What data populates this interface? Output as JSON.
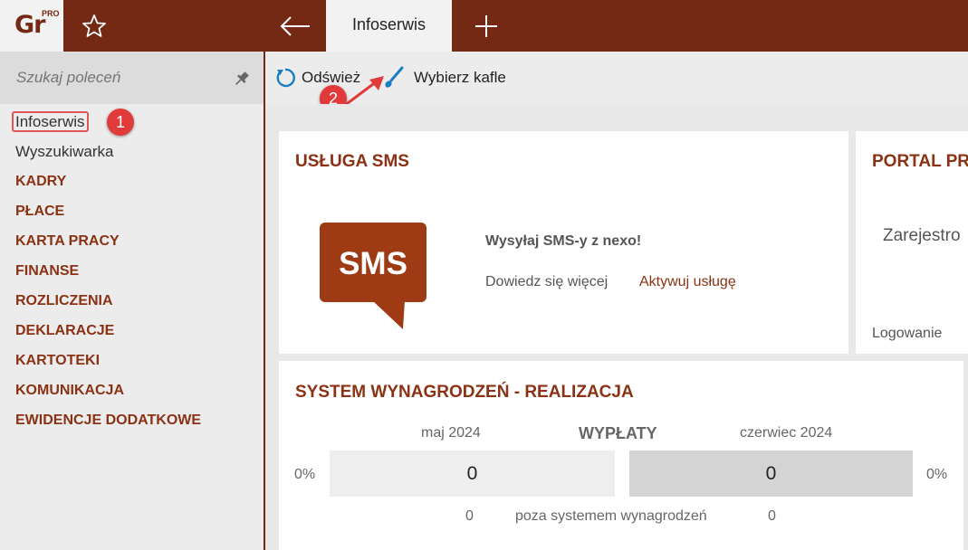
{
  "app": {
    "logo_text": "Gr",
    "logo_badge": "PRO"
  },
  "tabs": [
    {
      "label": "Infoserwis",
      "active": true
    }
  ],
  "search": {
    "placeholder": "Szukaj poleceń"
  },
  "sidebar": {
    "items": [
      {
        "label": "Infoserwis",
        "type": "plain",
        "active": true
      },
      {
        "label": "Wyszukiwarka",
        "type": "plain"
      },
      {
        "label": "KADRY",
        "type": "section"
      },
      {
        "label": "PŁACE",
        "type": "section"
      },
      {
        "label": "KARTA PRACY",
        "type": "section"
      },
      {
        "label": "FINANSE",
        "type": "section"
      },
      {
        "label": "ROZLICZENIA",
        "type": "section"
      },
      {
        "label": "DEKLARACJE",
        "type": "section"
      },
      {
        "label": "KARTOTEKI",
        "type": "section"
      },
      {
        "label": "KOMUNIKACJA",
        "type": "section"
      },
      {
        "label": "EWIDENCJE DODATKOWE",
        "type": "section"
      }
    ]
  },
  "toolbar": {
    "refresh_label": "Odśwież",
    "tiles_label": "Wybierz kafle"
  },
  "callouts": {
    "one": "1",
    "two": "2"
  },
  "tiles": {
    "sms": {
      "title": "USŁUGA SMS",
      "icon_text": "SMS",
      "headline": "Wysyłaj SMS-y z nexo!",
      "link_more": "Dowiedz się więcej",
      "link_activate": "Aktywuj usługę"
    },
    "portal": {
      "title": "PORTAL PR",
      "text": "Zarejestro",
      "login": "Logowanie"
    },
    "payroll": {
      "title": "SYSTEM WYNAGRODZEŃ - REALIZACJA",
      "month_left": "maj 2024",
      "center_label": "WYPŁATY",
      "month_right": "czerwiec 2024",
      "pct_left": "0%",
      "pct_right": "0%",
      "value_left": "0",
      "value_right": "0",
      "outside_left": "0",
      "outside_label": "poza systemem wynagrodzeń",
      "outside_right": "0"
    }
  },
  "colors": {
    "brand": "#742914",
    "section_text": "#8b3214",
    "callout": "#e03a3a",
    "sms_bubble": "#9e3b15",
    "refresh_icon": "#1a7ec4"
  }
}
